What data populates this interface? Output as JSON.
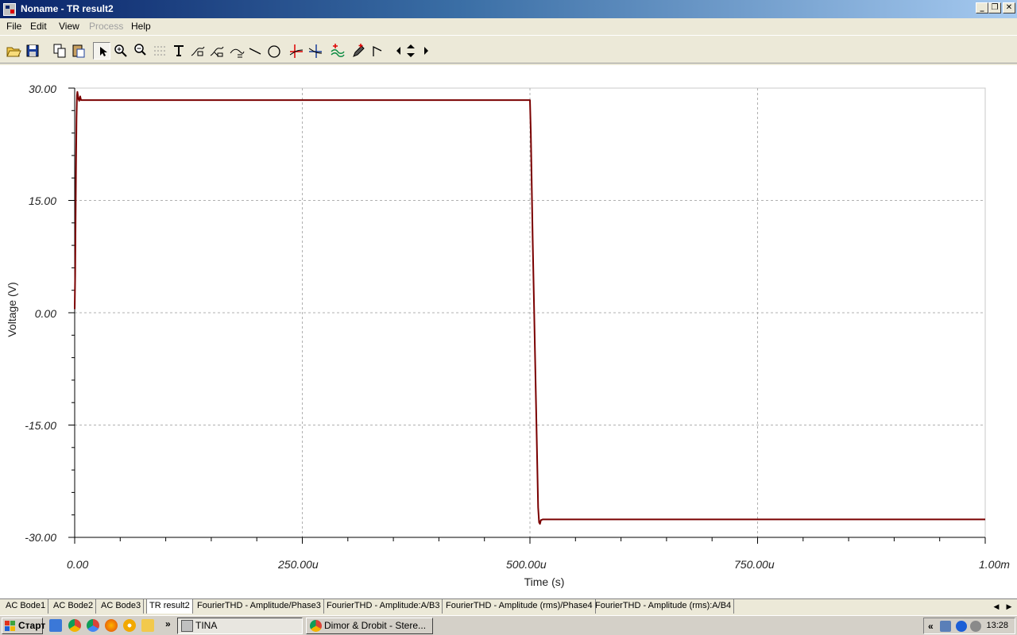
{
  "window": {
    "title": "Noname - TR result2",
    "controls": [
      "_",
      "❐",
      "✕"
    ]
  },
  "menu": {
    "items": [
      {
        "label": "File",
        "enabled": true
      },
      {
        "label": "Edit",
        "enabled": true
      },
      {
        "label": "View",
        "enabled": true
      },
      {
        "label": "Process",
        "enabled": false
      },
      {
        "label": "Help",
        "enabled": true
      }
    ]
  },
  "toolbar": {
    "tools": [
      "open-icon",
      "save-icon",
      "copy-icon",
      "paste-icon",
      "pointer-icon",
      "zoom-in-icon",
      "zoom-100-icon",
      "grid-icon",
      "text-icon",
      "curve-label-icon",
      "curve-label-2-icon",
      "auto-label-icon",
      "line-icon",
      "circle-icon",
      "cursor-a-icon",
      "cursor-b-icon",
      "add-curve-icon",
      "pen-icon",
      "marker-icon",
      "arrow-left-icon",
      "arrow-updown-icon",
      "arrow-right-icon"
    ]
  },
  "plot": {
    "ylabel": "Voltage (V)",
    "xlabel": "Time (s)",
    "yticks": [
      "30.00",
      "15.00",
      "0.00",
      "-15.00",
      "-30.00"
    ],
    "xticks": [
      "0.00",
      "250.00u",
      "500.00u",
      "750.00u",
      "1.00m"
    ]
  },
  "chart_data": {
    "type": "line",
    "xlabel": "Time (s)",
    "ylabel": "Voltage (V)",
    "xlim": [
      0,
      0.001
    ],
    "ylim": [
      -30,
      30
    ],
    "grid": true,
    "series": [
      {
        "color": "#7a0000",
        "x": [
          0,
          5e-07,
          1e-06,
          1.5e-06,
          2e-06,
          2.5e-06,
          3e-06,
          4e-06,
          5e-06,
          6e-06,
          7e-06,
          5e-05,
          0.0001,
          0.0002,
          0.0003,
          0.0004,
          0.0005,
          0.000501,
          0.000503,
          0.000505,
          0.000507,
          0.000509,
          0.00051,
          0.000511,
          0.000512,
          0.000514,
          0.00052,
          0.0006,
          0.0008,
          0.001
        ],
        "y": [
          0.5,
          5,
          12,
          20,
          26,
          29,
          29.5,
          28.6,
          28.3,
          28.9,
          28.4,
          28.4,
          28.4,
          28.4,
          28.4,
          28.4,
          28.4,
          24,
          10,
          -2,
          -14,
          -26,
          -28,
          -28.2,
          -27.7,
          -27.6,
          -27.6,
          -27.6,
          -27.6,
          -27.6
        ]
      }
    ]
  },
  "tabs": {
    "items": [
      "AC Bode1",
      "AC Bode2",
      "AC Bode3",
      "TR result2",
      "FourierTHD - Amplitude/Phase3",
      "FourierTHD - Amplitude:A/B3",
      "FourierTHD - Amplitude (rms)/Phase4",
      "FourierTHD - Amplitude (rms):A/B4"
    ],
    "active": 3
  },
  "taskbar": {
    "start_label": "Старт",
    "more": "»",
    "tasks": [
      {
        "label": "TINA",
        "active": true
      },
      {
        "label": "Dimor & Drobit - Stere...",
        "active": false
      }
    ],
    "tray_more": "«",
    "clock": "13:28"
  }
}
